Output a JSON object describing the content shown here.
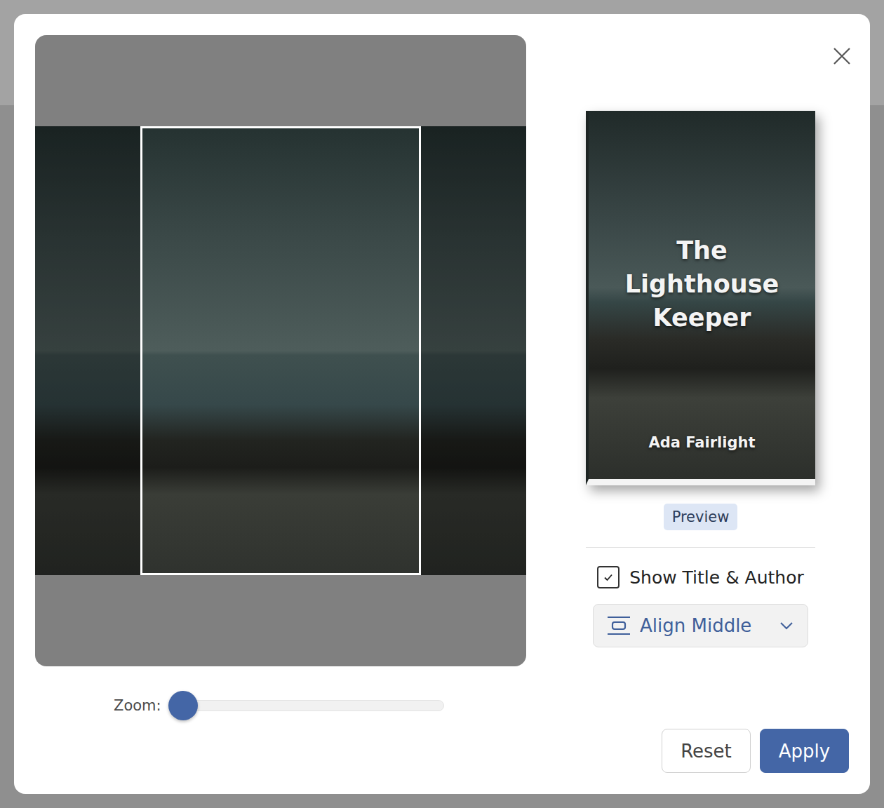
{
  "cropper": {
    "zoom_label": "Zoom:",
    "zoom": {
      "level": 0
    }
  },
  "preview": {
    "title": "The Lighthouse Keeper",
    "author": "Ada Fairlight",
    "badge": "Preview"
  },
  "options": {
    "show_title_author": {
      "label": "Show Title & Author",
      "checked": true
    },
    "align": {
      "label": "Align Middle",
      "expanded": false
    }
  },
  "buttons": [
    {
      "label": "Reset",
      "primary": false
    },
    {
      "label": "Apply",
      "primary": true
    }
  ]
}
